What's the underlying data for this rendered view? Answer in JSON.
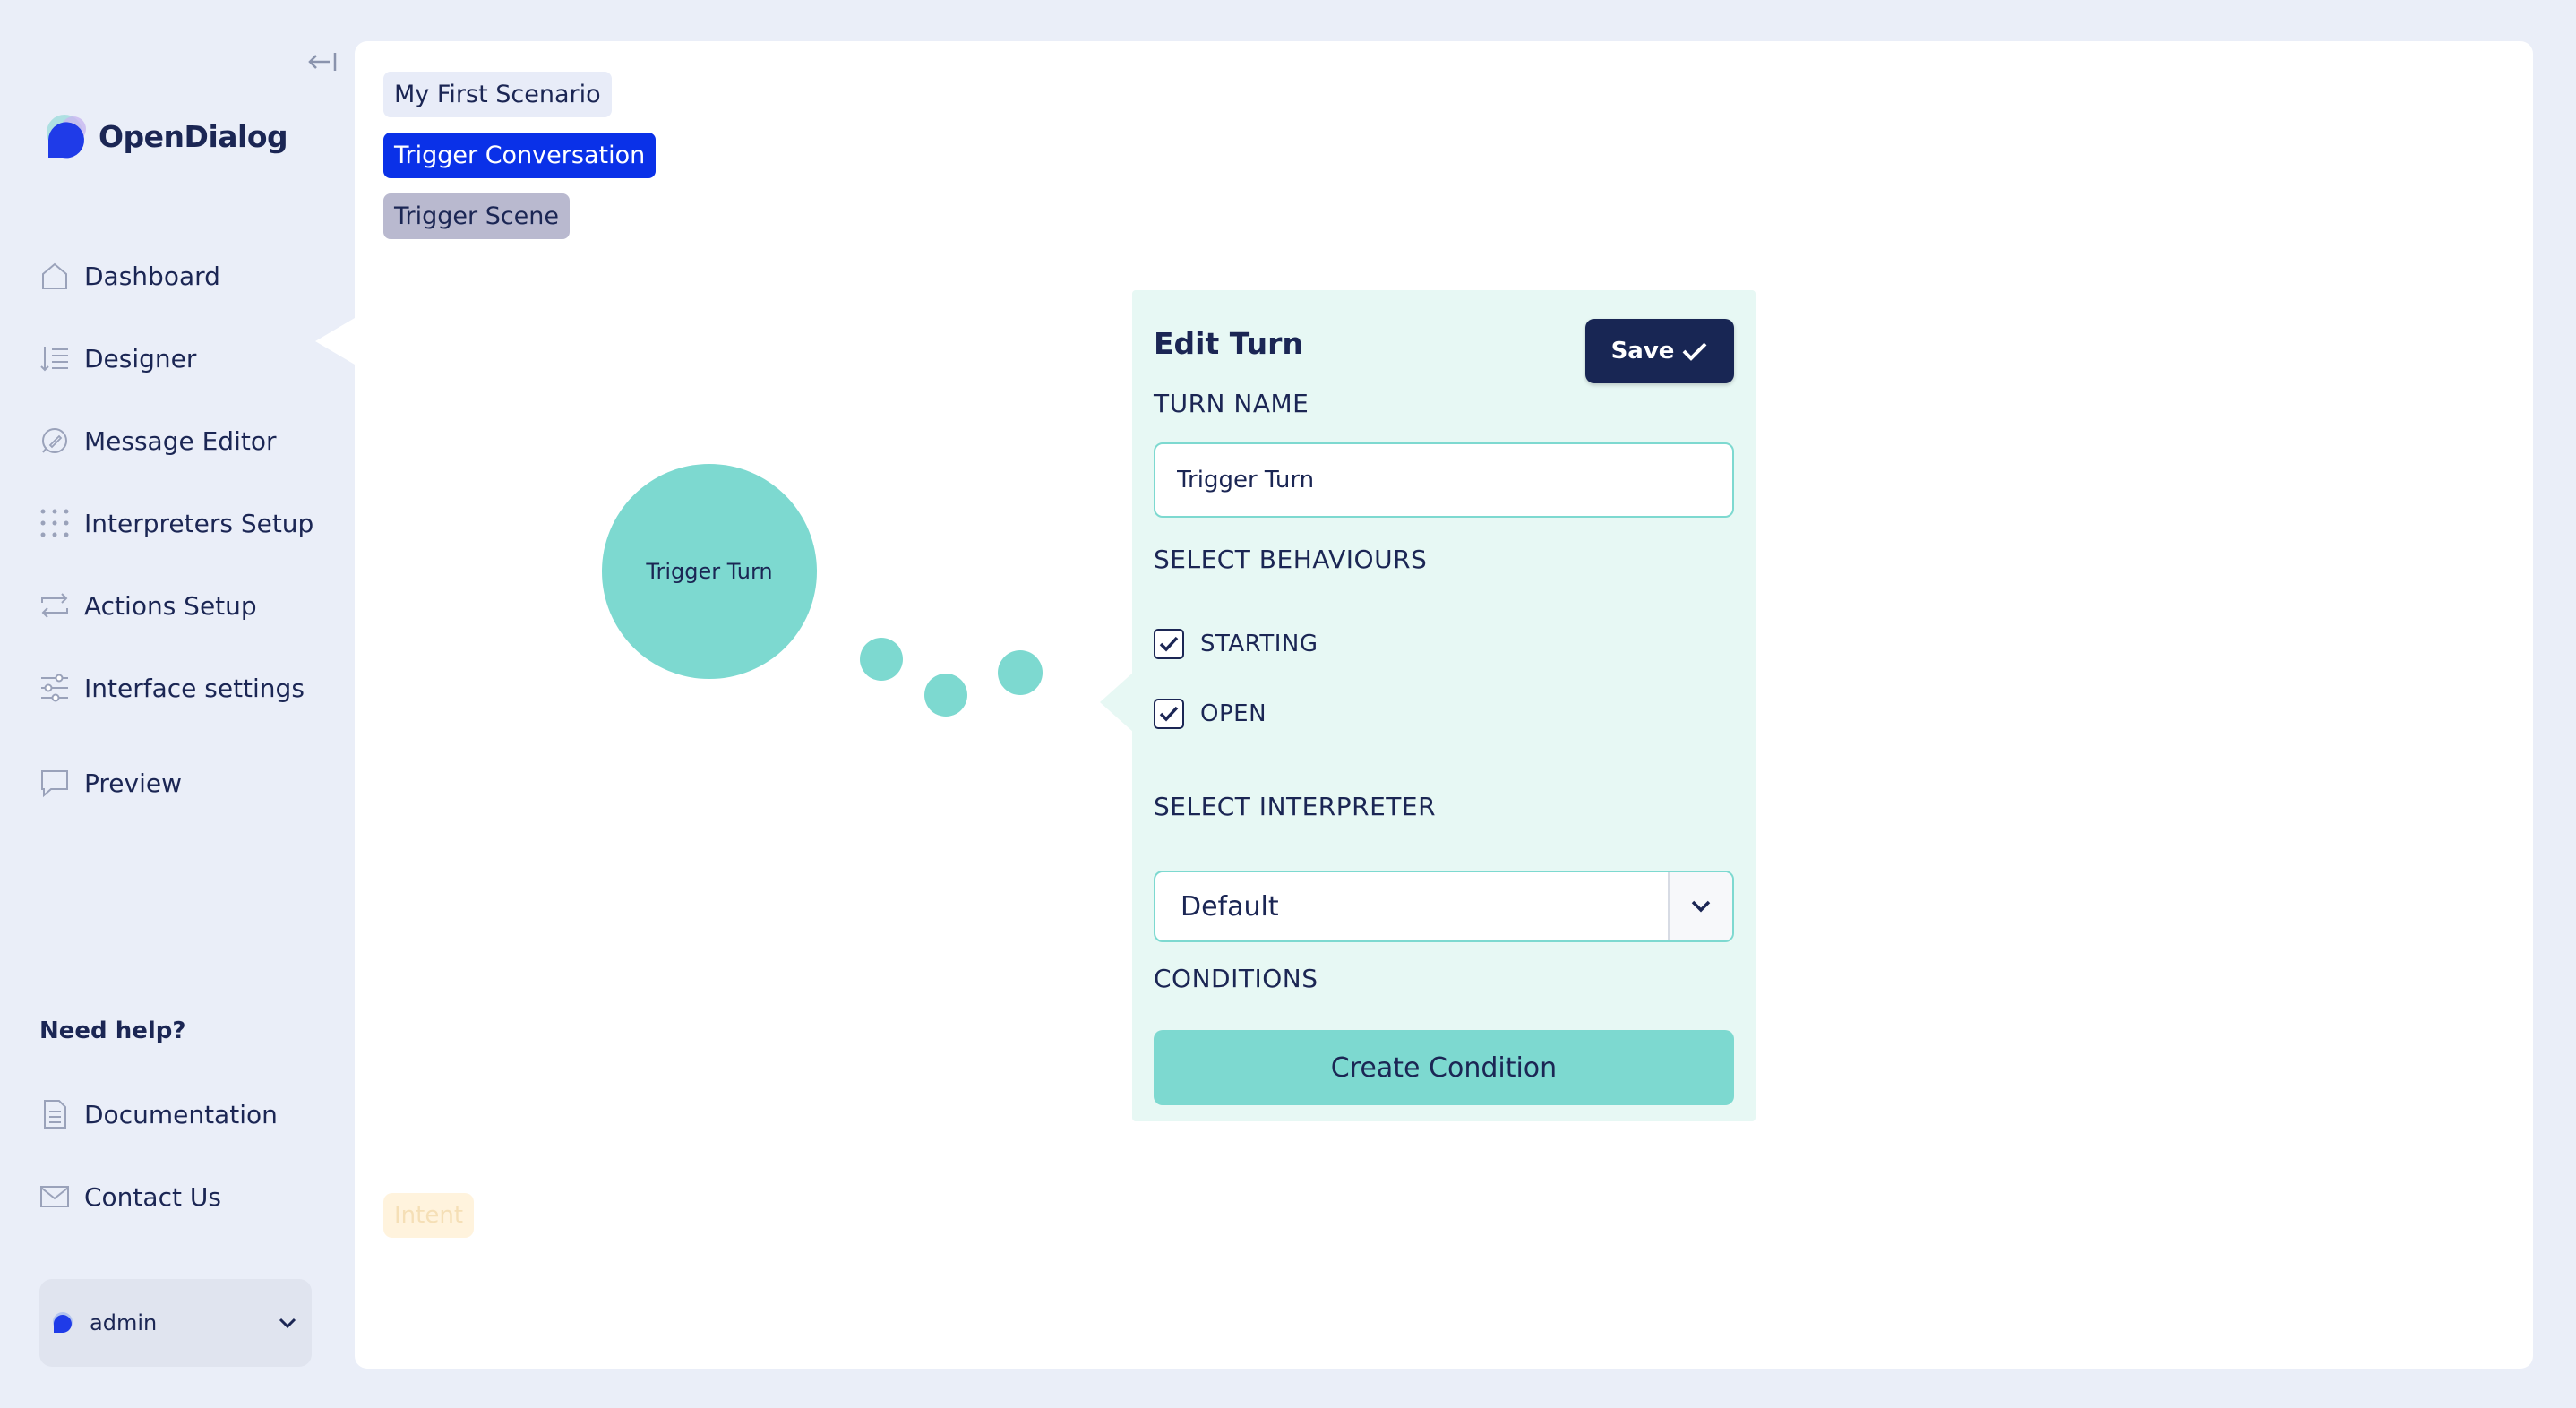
{
  "brand": {
    "name": "OpenDialog"
  },
  "sidebar": {
    "items": [
      {
        "label": "Dashboard",
        "icon": "home-icon"
      },
      {
        "label": "Designer",
        "icon": "designer-icon"
      },
      {
        "label": "Message Editor",
        "icon": "message-editor-icon"
      },
      {
        "label": "Interpreters Setup",
        "icon": "grid-dots-icon"
      },
      {
        "label": "Actions Setup",
        "icon": "repeat-arrows-icon"
      },
      {
        "label": "Interface settings",
        "icon": "sliders-icon"
      }
    ],
    "preview": {
      "label": "Preview",
      "icon": "chat-bubble-icon"
    },
    "help_title": "Need help?",
    "help_items": [
      {
        "label": "Documentation",
        "icon": "document-icon"
      },
      {
        "label": "Contact Us",
        "icon": "envelope-icon"
      }
    ],
    "user": {
      "name": "admin"
    }
  },
  "breadcrumbs": {
    "scenario": "My First Scenario",
    "conversation": "Trigger Conversation",
    "scene": "Trigger Scene"
  },
  "canvas": {
    "turn_node_label": "Trigger Turn",
    "intent_chip": "Intent"
  },
  "edit_panel": {
    "title": "Edit Turn",
    "save_label": "Save",
    "turn_name_label": "TURN NAME",
    "turn_name_value": "Trigger Turn",
    "behaviours_label": "SELECT BEHAVIOURS",
    "behaviours": [
      {
        "label": "STARTING",
        "checked": true
      },
      {
        "label": "OPEN",
        "checked": true
      }
    ],
    "interpreter_label": "SELECT INTERPRETER",
    "interpreter_value": "Default",
    "conditions_label": "CONDITIONS",
    "create_condition_label": "Create Condition"
  },
  "colors": {
    "navy": "#1b2654",
    "accent_blue": "#0a31e8",
    "teal": "#7dd9d0",
    "panel_bg": "#e7f8f4",
    "app_bg": "#eaeef8"
  }
}
